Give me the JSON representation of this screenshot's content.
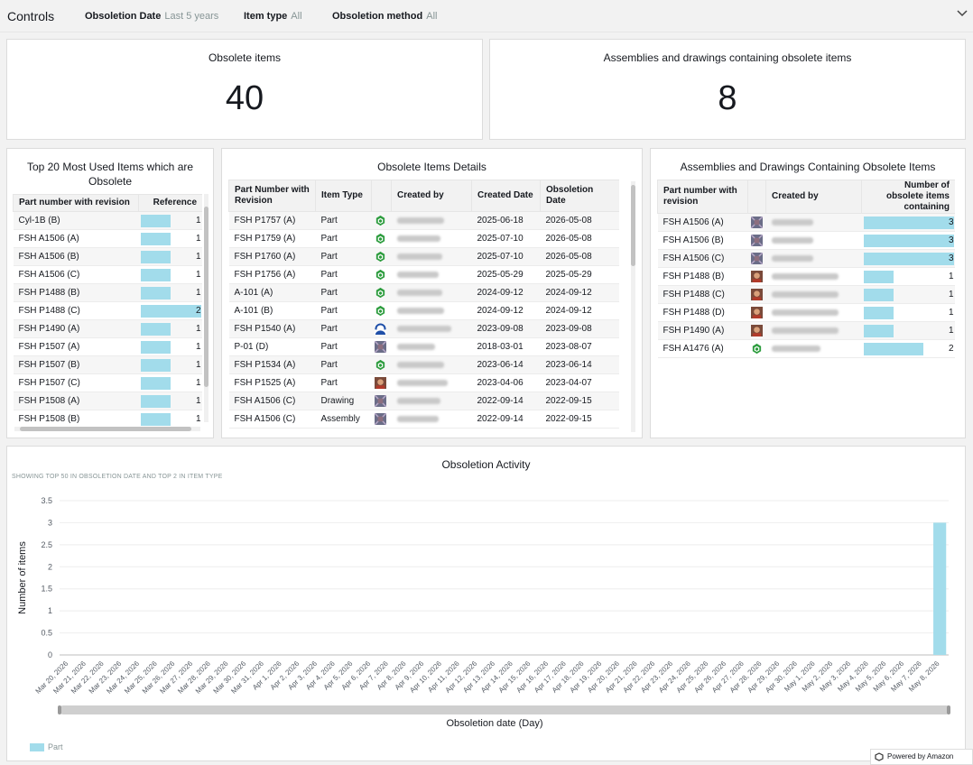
{
  "controls": {
    "title": "Controls",
    "filters": [
      {
        "label": "Obsoletion Date",
        "value": "Last 5 years"
      },
      {
        "label": "Item type",
        "value": "All"
      },
      {
        "label": "Obsoletion method",
        "value": "All"
      }
    ]
  },
  "kpi": {
    "obsolete_items": {
      "title": "Obsolete items",
      "value": "40"
    },
    "assemblies": {
      "title": "Assemblies and drawings containing obsolete items",
      "value": "8"
    }
  },
  "top20": {
    "title": "Top 20 Most Used Items which are Obsolete",
    "columns": [
      "Part number with revision",
      "Reference"
    ],
    "max": 2,
    "rows": [
      {
        "part": "Cyl-1B (B)",
        "ref": 1
      },
      {
        "part": "FSH A1506 (A)",
        "ref": 1
      },
      {
        "part": "FSH A1506 (B)",
        "ref": 1
      },
      {
        "part": "FSH A1506 (C)",
        "ref": 1
      },
      {
        "part": "FSH P1488 (B)",
        "ref": 1
      },
      {
        "part": "FSH P1488 (C)",
        "ref": 2
      },
      {
        "part": "FSH P1490 (A)",
        "ref": 1
      },
      {
        "part": "FSH P1507 (A)",
        "ref": 1
      },
      {
        "part": "FSH P1507 (B)",
        "ref": 1
      },
      {
        "part": "FSH P1507 (C)",
        "ref": 1
      },
      {
        "part": "FSH P1508 (A)",
        "ref": 1
      },
      {
        "part": "FSH P1508 (B)",
        "ref": 1
      }
    ]
  },
  "details": {
    "title": "Obsolete Items Details",
    "columns": [
      "Part Number with Revision",
      "Item Type",
      "",
      "Created by",
      "Created Date",
      "Obsoletion Date"
    ],
    "rows": [
      {
        "part": "FSH P1757 (A)",
        "type": "Part",
        "icon": "green-hex-icon",
        "created": "2025-06-18",
        "obsoleted": "2026-05-08"
      },
      {
        "part": "FSH P1759 (A)",
        "type": "Part",
        "icon": "green-hex-icon",
        "created": "2025-07-10",
        "obsoleted": "2026-05-08"
      },
      {
        "part": "FSH P1760 (A)",
        "type": "Part",
        "icon": "green-hex-icon",
        "created": "2025-07-10",
        "obsoleted": "2026-05-08"
      },
      {
        "part": "FSH P1756 (A)",
        "type": "Part",
        "icon": "green-hex-icon",
        "created": "2025-05-29",
        "obsoleted": "2025-05-29"
      },
      {
        "part": "A-101 (A)",
        "type": "Part",
        "icon": "green-hex-icon",
        "created": "2024-09-12",
        "obsoleted": "2024-09-12"
      },
      {
        "part": "A-101 (B)",
        "type": "Part",
        "icon": "green-hex-icon",
        "created": "2024-09-12",
        "obsoleted": "2024-09-12"
      },
      {
        "part": "FSH P1540 (A)",
        "type": "Part",
        "icon": "person-avatar-icon",
        "created": "2023-09-08",
        "obsoleted": "2023-09-08"
      },
      {
        "part": "P-01 (D)",
        "type": "Part",
        "icon": "photo-avatar-icon",
        "created": "2018-03-01",
        "obsoleted": "2023-08-07"
      },
      {
        "part": "FSH P1534 (A)",
        "type": "Part",
        "icon": "green-hex-icon",
        "created": "2023-06-14",
        "obsoleted": "2023-06-14"
      },
      {
        "part": "FSH P1525 (A)",
        "type": "Part",
        "icon": "face-avatar-icon",
        "created": "2023-04-06",
        "obsoleted": "2023-04-07"
      },
      {
        "part": "FSH A1506 (C)",
        "type": "Drawing",
        "icon": "photo-avatar-icon",
        "created": "2022-09-14",
        "obsoleted": "2022-09-15"
      },
      {
        "part": "FSH A1506 (C)",
        "type": "Assembly",
        "icon": "photo-avatar-icon",
        "created": "2022-09-14",
        "obsoleted": "2022-09-15"
      }
    ]
  },
  "assemblies": {
    "title": "Assemblies and Drawings Containing Obsolete Items",
    "columns": [
      "Part number with revision",
      "",
      "Created by",
      "Number of obsolete items containing"
    ],
    "max": 3,
    "rows": [
      {
        "part": "FSH A1506 (A)",
        "icon": "photo-avatar-icon",
        "count": 3
      },
      {
        "part": "FSH A1506 (B)",
        "icon": "photo-avatar-icon",
        "count": 3
      },
      {
        "part": "FSH A1506 (C)",
        "icon": "photo-avatar-icon",
        "count": 3
      },
      {
        "part": "FSH P1488 (B)",
        "icon": "face-avatar-icon",
        "count": 1
      },
      {
        "part": "FSH P1488 (C)",
        "icon": "face-avatar-icon",
        "count": 1
      },
      {
        "part": "FSH P1488 (D)",
        "icon": "face-avatar-icon",
        "count": 1
      },
      {
        "part": "FSH P1490 (A)",
        "icon": "face-avatar-icon",
        "count": 1
      },
      {
        "part": "FSH A1476 (A)",
        "icon": "green-hex-icon",
        "count": 2
      }
    ]
  },
  "activity": {
    "title": "Obsoletion Activity",
    "subtitle": "SHOWING TOP 50 IN OBSOLETION DATE AND TOP 2 IN ITEM TYPE",
    "powered_by": "Powered by Amazon Quick"
  },
  "chart_data": {
    "type": "bar",
    "title": "Obsoletion Activity",
    "xlabel": "Obsoletion date (Day)",
    "ylabel": "Number of items",
    "ylim": [
      0,
      3.5
    ],
    "yticks": [
      0,
      0.5,
      1,
      1.5,
      2,
      2.5,
      3,
      3.5
    ],
    "grid": true,
    "legend": "bottom-left",
    "categories": [
      "Mar 20, 2026",
      "Mar 21, 2026",
      "Mar 22, 2026",
      "Mar 23, 2026",
      "Mar 24, 2026",
      "Mar 25, 2026",
      "Mar 26, 2026",
      "Mar 27, 2026",
      "Mar 28, 2026",
      "Mar 29, 2026",
      "Mar 30, 2026",
      "Mar 31, 2026",
      "Apr 1, 2026",
      "Apr 2, 2026",
      "Apr 3, 2026",
      "Apr 4, 2026",
      "Apr 5, 2026",
      "Apr 6, 2026",
      "Apr 7, 2026",
      "Apr 8, 2026",
      "Apr 9, 2026",
      "Apr 10, 2026",
      "Apr 11, 2026",
      "Apr 12, 2026",
      "Apr 13, 2026",
      "Apr 14, 2026",
      "Apr 15, 2026",
      "Apr 16, 2026",
      "Apr 17, 2026",
      "Apr 18, 2026",
      "Apr 19, 2026",
      "Apr 20, 2026",
      "Apr 21, 2026",
      "Apr 22, 2026",
      "Apr 23, 2026",
      "Apr 24, 2026",
      "Apr 25, 2026",
      "Apr 26, 2026",
      "Apr 27, 2026",
      "Apr 28, 2026",
      "Apr 29, 2026",
      "Apr 30, 2026",
      "May 1, 2026",
      "May 2, 2026",
      "May 3, 2026",
      "May 4, 2026",
      "May 5, 2026",
      "May 6, 2026",
      "May 7, 2026",
      "May 8, 2026"
    ],
    "series": [
      {
        "name": "Part",
        "color": "#a2dceb",
        "values": [
          0,
          0,
          0,
          0,
          0,
          0,
          0,
          0,
          0,
          0,
          0,
          0,
          0,
          0,
          0,
          0,
          0,
          0,
          0,
          0,
          0,
          0,
          0,
          0,
          0,
          0,
          0,
          0,
          0,
          0,
          0,
          0,
          0,
          0,
          0,
          0,
          0,
          0,
          0,
          0,
          0,
          0,
          0,
          0,
          0,
          0,
          0,
          0,
          0,
          3
        ]
      }
    ]
  }
}
